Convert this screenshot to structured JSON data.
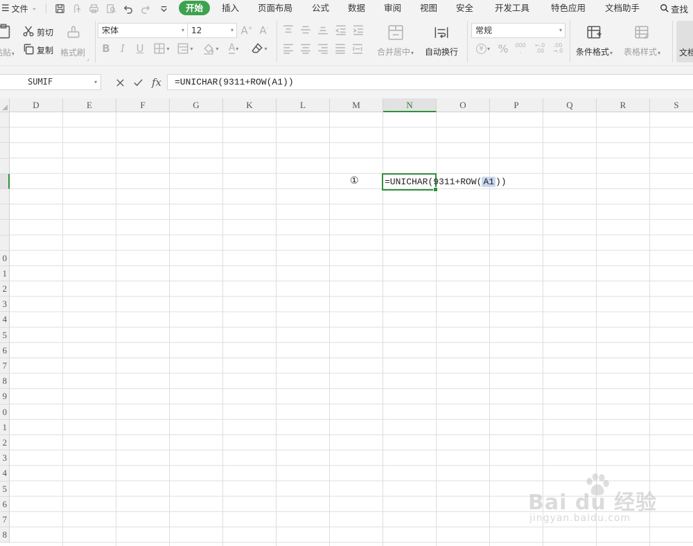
{
  "menubar": {
    "file_label": "文件",
    "tabs": [
      "开始",
      "插入",
      "页面布局",
      "公式",
      "数据",
      "审阅",
      "视图",
      "安全",
      "开发工具",
      "特色应用",
      "文档助手"
    ],
    "active_tab": "开始",
    "search_label": "查找"
  },
  "ribbon": {
    "paste_label": "粘贴",
    "cut_label": "剪切",
    "copy_label": "复制",
    "format_painter_label": "格式刷",
    "font_name": "宋体",
    "font_size": "12",
    "merge_center_label": "合并居中",
    "wrap_text_label": "自动换行",
    "number_format": "常规",
    "conditional_format_label": "条件格式",
    "table_style_label": "表格样式",
    "document_label": "文档"
  },
  "formula_bar": {
    "name_box": "SUMIF",
    "fx_label": "fx",
    "formula": "=UNICHAR(9311+ROW(A1))"
  },
  "grid": {
    "columns": [
      "D",
      "E",
      "F",
      "G",
      "K",
      "L",
      "M",
      "N",
      "O",
      "P",
      "Q",
      "R",
      "S"
    ],
    "selected_column": "N",
    "row_labels": [
      "",
      "",
      "",
      "",
      "",
      "",
      "",
      "",
      "",
      "0",
      "1",
      "2",
      "3",
      "4",
      "5",
      "6",
      "7",
      "8",
      "9",
      "0",
      "1",
      "2",
      "3",
      "4",
      "5",
      "6",
      "7",
      "8"
    ],
    "selected_row_index": 4,
    "cell_m5": "①",
    "editor": {
      "prefix": "=UNICHAR(9311+ROW(",
      "ref": "A1",
      "suffix": "))"
    }
  },
  "watermark": {
    "main": "Bai du 经验",
    "sub": "jingyan.baidu.com"
  },
  "colors": {
    "accent": "#3ea14f",
    "selection": "#2f8f3e",
    "ref_highlight": "#c9d8ee"
  }
}
